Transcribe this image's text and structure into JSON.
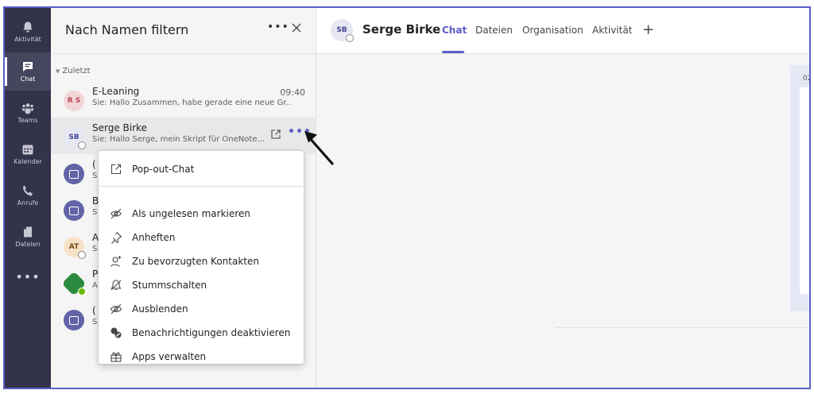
{
  "appbar": {
    "items": [
      {
        "label": "Aktivität",
        "icon": "bell-icon"
      },
      {
        "label": "Chat",
        "icon": "chat-icon",
        "active": true
      },
      {
        "label": "Teams",
        "icon": "teams-icon"
      },
      {
        "label": "Kalender",
        "icon": "calendar-icon"
      },
      {
        "label": "Anrufe",
        "icon": "phone-icon"
      },
      {
        "label": "Dateien",
        "icon": "file-icon"
      }
    ],
    "more_label": "•••"
  },
  "chatlist": {
    "filter_placeholder": "Nach Namen filtern",
    "filter_more": "•••",
    "section_label": "Zuletzt",
    "items": [
      {
        "name": "E-Leaning",
        "time": "09:40",
        "preview": "Sie: Hallo Zusammen, habe gerade eine neue Gr...",
        "initials": "R S"
      },
      {
        "name": "Serge Birke",
        "preview": "Sie: Hallo Serge, mein Skript für OneNote...",
        "initials": "SB",
        "selected": true
      },
      {
        "name": "(",
        "preview": "S"
      },
      {
        "name": "B",
        "preview": "S"
      },
      {
        "name": "A",
        "preview": "S",
        "initials": "AT"
      },
      {
        "name": "P",
        "preview": "A"
      },
      {
        "name": "(",
        "preview": "S"
      }
    ],
    "row_more": "•••"
  },
  "context_menu": {
    "items": [
      {
        "label": "Pop-out-Chat",
        "icon": "popout-icon"
      },
      {
        "label": "Als ungelesen markieren",
        "icon": "mark-unread-icon"
      },
      {
        "label": "Anheften",
        "icon": "pin-icon"
      },
      {
        "label": "Zu bevorzugten Kontakten",
        "icon": "add-contact-icon"
      },
      {
        "label": "Stummschalten",
        "icon": "mute-icon"
      },
      {
        "label": "Ausblenden",
        "icon": "hide-icon"
      },
      {
        "label": "Benachrichtigungen deaktivieren",
        "icon": "notifications-off-icon"
      },
      {
        "label": "Apps verwalten",
        "icon": "apps-icon"
      }
    ]
  },
  "header": {
    "initials": "SB",
    "name": "Serge Birke",
    "tabs": [
      {
        "label": "Chat",
        "active": true
      },
      {
        "label": "Dateien"
      },
      {
        "label": "Organisation"
      },
      {
        "label": "Aktivität"
      }
    ],
    "add_tab": "+"
  },
  "side_panel": {
    "text": "02"
  },
  "colors": {
    "brand": "#5b5fc7",
    "appbar": "#33344a",
    "available": "#6bb700"
  }
}
